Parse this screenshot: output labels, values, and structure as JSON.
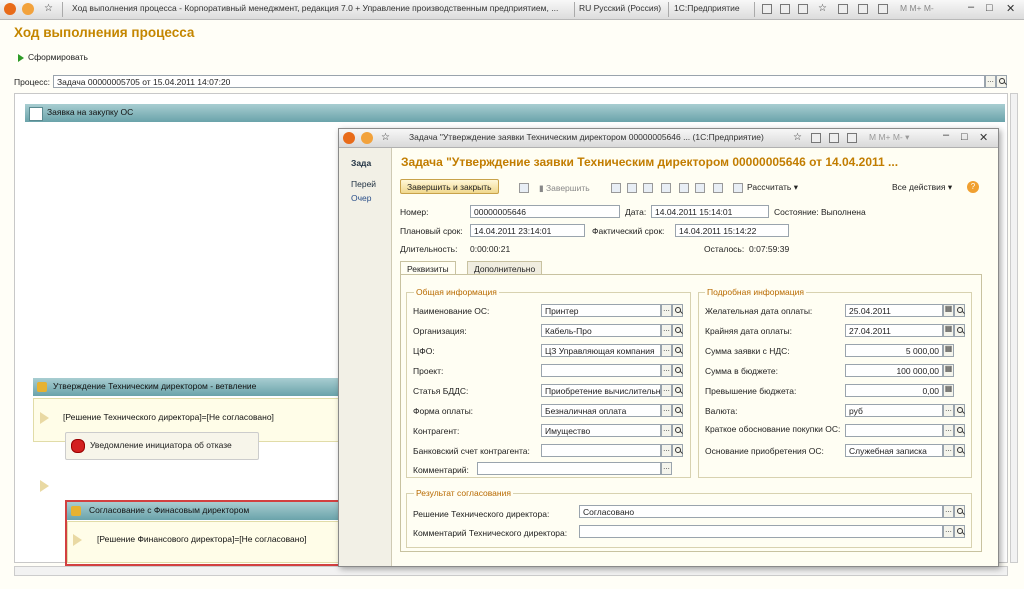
{
  "titlebar": {
    "tab_text": "Ход выполнения процесса - Корпоративный менеджмент, редакция 7.0 + Управление производственным предприятием, ...",
    "lang": "RU Русский (Россия)",
    "app": "1С:Предприятие"
  },
  "main": {
    "title": "Ход выполнения процесса",
    "generate_label": "Сформировать",
    "process_label": "Процесс:",
    "process_value": "Задача 00000005705 от 15.04.2011 14:07:20",
    "nodes": {
      "top": "Заявка на закупку ОС",
      "branch": "Утверждение Техническим директором - ветвление",
      "cond1": "[Решение Технического директора]=[Не согласовано]",
      "notify": "Уведомление инициатора об отказе",
      "fin": "Согласование с Финасовым директором",
      "cond2": "[Решение Финансового директора]=[Не согласовано]"
    }
  },
  "window": {
    "title": "Задача \"Утверждение заявки Техническим директором  00000005646 ...  (1С:Предприятие)",
    "left_panel": [
      "Зада",
      "Перей",
      "Очер"
    ],
    "heading": "Задача \"Утверждение заявки Техническим директором  00000005646 от 14.04.2011 ...",
    "toolbar": {
      "finish_close": "Завершить и закрыть",
      "finish": "Завершить",
      "calc": "Рассчитать",
      "all_actions": "Все действия"
    },
    "header": {
      "number_label": "Номер:",
      "number": "00000005646",
      "date_label": "Дата:",
      "date": "14.04.2011 15:14:01",
      "state_label": "Состояние:",
      "state": "Выполнена",
      "plan_label": "Плановый срок:",
      "plan": "14.04.2011 23:14:01",
      "fact_label": "Фактический срок:",
      "fact": "14.04.2011 15:14:22",
      "duration_label": "Длительность:",
      "duration": "0:00:00:21",
      "remain_label": "Осталось:",
      "remain": "0:07:59:39"
    },
    "tabs": [
      "Реквизиты",
      "Дополнительно"
    ],
    "general": {
      "title": "Общая информация",
      "fields": [
        {
          "label": "Наименование ОС:",
          "value": "Принтер"
        },
        {
          "label": "Организация:",
          "value": "Кабель-Про"
        },
        {
          "label": "ЦФО:",
          "value": "ЦЗ Управляющая компания"
        },
        {
          "label": "Проект:",
          "value": ""
        },
        {
          "label": "Статья БДДС:",
          "value": "Приобретение вычислительн"
        },
        {
          "label": "Форма оплаты:",
          "value": "Безналичная оплата"
        },
        {
          "label": "Контрагент:",
          "value": "Имущество"
        },
        {
          "label": "Банковский счет контрагента:",
          "value": ""
        },
        {
          "label": "Комментарий:",
          "value": ""
        }
      ]
    },
    "detail": {
      "title": "Подробная информация",
      "fields": [
        {
          "label": "Желательная дата оплаты:",
          "value": "25.04.2011"
        },
        {
          "label": "Крайняя дата оплаты:",
          "value": "27.04.2011"
        },
        {
          "label": "Сумма заявки с НДС:",
          "value": "5 000,00"
        },
        {
          "label": "Сумма в бюджете:",
          "value": "100 000,00"
        },
        {
          "label": "Превышение бюджета:",
          "value": "0,00"
        },
        {
          "label": "Валюта:",
          "value": "руб"
        },
        {
          "label": "Краткое обоснование покупки ОС:",
          "value": ""
        },
        {
          "label": "Основание приобретения ОС:",
          "value": "Служебная записка"
        }
      ]
    },
    "result": {
      "title": "Результат согласования",
      "decision_label": "Решение Технического директора:",
      "decision": "Согласовано",
      "comment_label": "Комментарий Технического директора:",
      "comment": ""
    }
  }
}
